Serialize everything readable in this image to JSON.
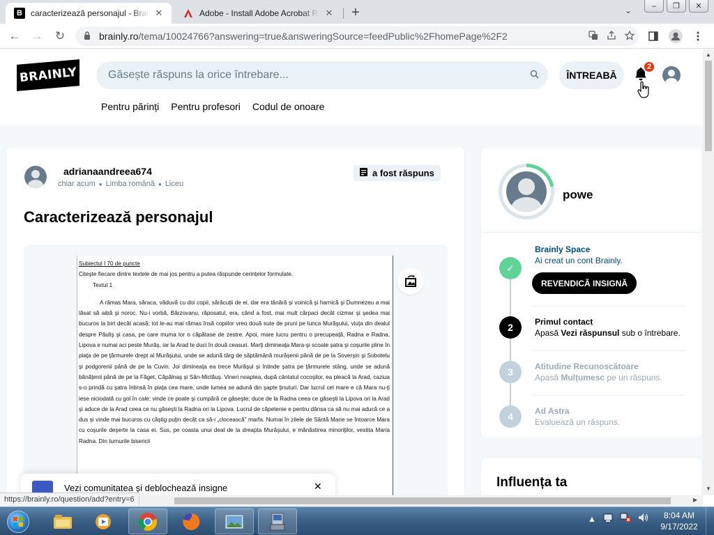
{
  "browser": {
    "tabs": [
      {
        "favicon": "B",
        "title": "caracterizează personajul  - Brainly.ro",
        "close": "✕"
      },
      {
        "favicon": "A",
        "title": "Adobe - Install Adobe Acrobat Reader",
        "close": "✕"
      }
    ],
    "new_tab": "+",
    "tab_menu": "⌄",
    "window_buttons": [
      "–",
      "❐",
      "✕"
    ],
    "nav": {
      "back": "←",
      "forward": "→",
      "reload": "↻"
    },
    "url_host": "brainly.ro",
    "url_path": "/tema/10024766?answering=true&answeringSource=feedPublic%2FhomePage%2F2",
    "status_url": "https://brainly.ro/question/add?entry=6"
  },
  "header": {
    "logo": "BRAINLY",
    "search_placeholder": "Găsește răspuns la orice întrebare...",
    "ask_button": "ÎNTREABĂ",
    "notification_count": "2",
    "subnav": [
      "Pentru părinți",
      "Pentru profesori",
      "Codul de onoare"
    ]
  },
  "question": {
    "username": "adrianaandreea674",
    "time": "chiar acum",
    "subject": "Limba română",
    "level": "Liceu",
    "answered_label": "a fost răspuns",
    "title": "Caracterizează personajul",
    "document": {
      "line1": "Subiectul I 70 de puncte",
      "line2": "Citește fiecare dintre textele de mai jos pentru a putea răspunde cerințelor formulate.",
      "line3": "Textul 1",
      "body": "A rămas Mara, săraca, văduvă cu doi copii, sărăcuţii de ei, dar era tânără şi voinică şi harnică şi Dumnezeu a mai lăsat să aibă şi noroc. Nu-i vorbă, Bârzovanu, răposatul, era, când a fost, mai mult cârpaci decât cizmar şi şedea mai bucuros la birt decât acasă; tot le-au mai rămas însă copiilor vreo două sute de pruni pe lunca Murăşului, viuţa din dealul despre Păuliş şi casa, pe care muma lor o căpătase de zestre. Apoi, mare lucru pentru o precupeaţă, Radna e Radna, Lipova e numai aci peste Murăş, iar la Arad te duci în două ceasuri. Marţi dimineaţa Mara-şi scoate şatra şi coşurile pline în piaţa de pe ţărmurele drept al Murăşului, unde se adună târg de săptămână murăşenii până de pe la Soverşin şi Sobotelu şi podgorenii până de pe la Cuvin. Joi dimineaţa ea trece Murăşul şi întinde şatra pe ţărmurele stâng, unde se adună bănăţenii până de pe la Făget, Căpâlnaş şi Sân-Miclăuş. Vineri noaptea, după cântatul cocoşilor, ea pleacă la Arad, caziua s-o prindă cu şatra întinsă în piaţa cea mare, unde lumea se adună din şapte ţinuturi. Dar lucrul cel mare e că Mara nu-ţi iese niciodată cu gol în cale; vinde ce poate şi cumpără ce găseşte; duce de la Radna ceea ce găseşti la Lipova ori la Arad şi aduce de la Arad ceea ce nu găseşti la Radna ori la Lipova. Lucrul de căpetenie e pentru dânsa ca să nu mai aducă ce a dus şi vinde mai bucuros cu câştig puţin decât ca să-i „clocească” marfa. Numai în zilele de Sântă Marie se întoarce Mara cu coşurile deşerte la casa ei. Sus, pe coasta unui deal de la dreapta Murăşului, e mănăstirea minoriţilor, vestita Maria Radna. Din turnurile bisericii"
    }
  },
  "toast": {
    "text": "Vezi comunitatea și deblochează insigne",
    "close": "✕"
  },
  "profile": {
    "name": "powe",
    "progress_fraction": 0.22,
    "steps": [
      {
        "marker": "✓",
        "title": "Brainly Space",
        "desc": "Ai creat un cont Brainly.",
        "button": "REVENDICĂ INSIGNĂ",
        "state": "done"
      },
      {
        "marker": "2",
        "title": "Primul contact",
        "desc_pre": "Apasă ",
        "desc_bold": "Vezi răspunsul",
        "desc_post": " sub o întrebare.",
        "state": "active"
      },
      {
        "marker": "3",
        "title": "Atitudine Recunoscătoare",
        "desc_pre": "Apasă ",
        "desc_bold": "Mulțumesc",
        "desc_post": " pe un răspuns.",
        "state": "locked"
      },
      {
        "marker": "4",
        "title": "Ad Astra",
        "desc": "Evaluează un răspuns.",
        "state": "locked"
      }
    ]
  },
  "influence": {
    "title": "Influența ta"
  },
  "taskbar": {
    "clock_time": "8:04 AM",
    "clock_date": "9/17/2022"
  },
  "colors": {
    "brand": "#000000",
    "accent_green": "#60d399",
    "notification_red": "#e6360f",
    "muted": "#687b8c"
  }
}
